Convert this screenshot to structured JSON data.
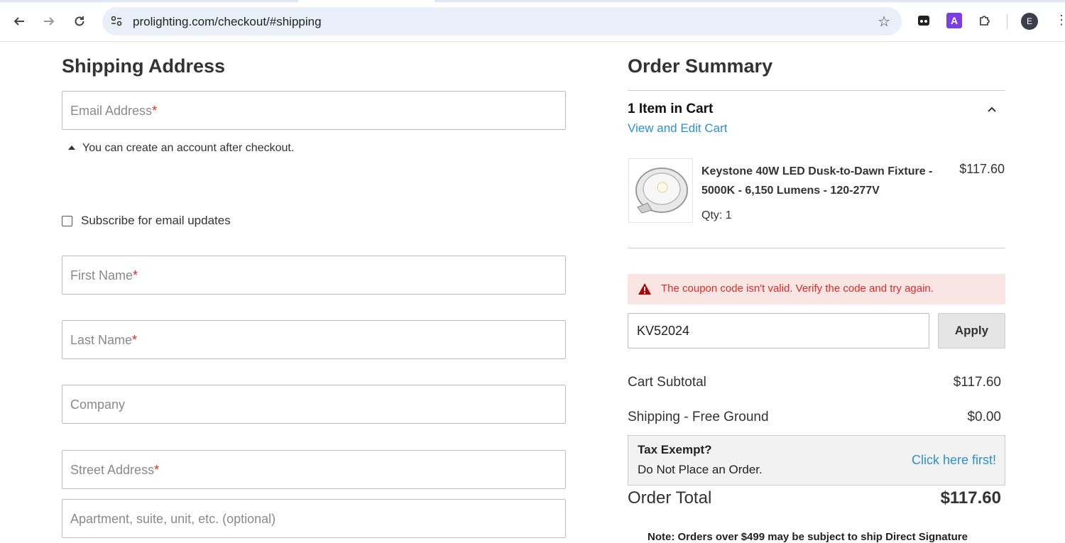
{
  "browser": {
    "url": "prolighting.com/checkout/#shipping",
    "profile_initial": "E",
    "extension_label": "A"
  },
  "shipping": {
    "title": "Shipping Address",
    "email_placeholder": "Email Address",
    "account_tip": "You can create an account after checkout.",
    "subscribe_label": "Subscribe for email updates",
    "first_name_placeholder": "First Name",
    "last_name_placeholder": "Last Name",
    "company_placeholder": "Company",
    "street_placeholder": "Street Address",
    "apartment_placeholder": "Apartment, suite, unit, etc. (optional)",
    "required_mark": "*"
  },
  "summary": {
    "title": "Order Summary",
    "cart_count": "1 Item in Cart",
    "view_edit_link": "View and Edit Cart",
    "item": {
      "name": "Keystone 40W LED Dusk-to-Dawn Fixture - 5000K - 6,150 Lumens - 120-277V",
      "price": "$117.60",
      "qty": "Qty: 1"
    },
    "coupon_error": "The coupon code isn't valid. Verify the code and try again.",
    "coupon_value": "KV52024",
    "apply_label": "Apply",
    "subtotal_label": "Cart Subtotal",
    "subtotal_value": "$117.60",
    "shipping_label": "Shipping - Free Ground",
    "shipping_value": "$0.00",
    "tax_title": "Tax Exempt?",
    "tax_text": "Do Not Place an Order.",
    "tax_link": "Click here first!",
    "total_label": "Order Total",
    "total_value": "$117.60",
    "note": "Note: Orders over $499 may be subject to ship Direct Signature"
  },
  "colors": {
    "link": "#2a91d1",
    "error_text": "#e02b27",
    "error_bg": "#fae5e5",
    "extension_purple": "#7b3fe4"
  }
}
